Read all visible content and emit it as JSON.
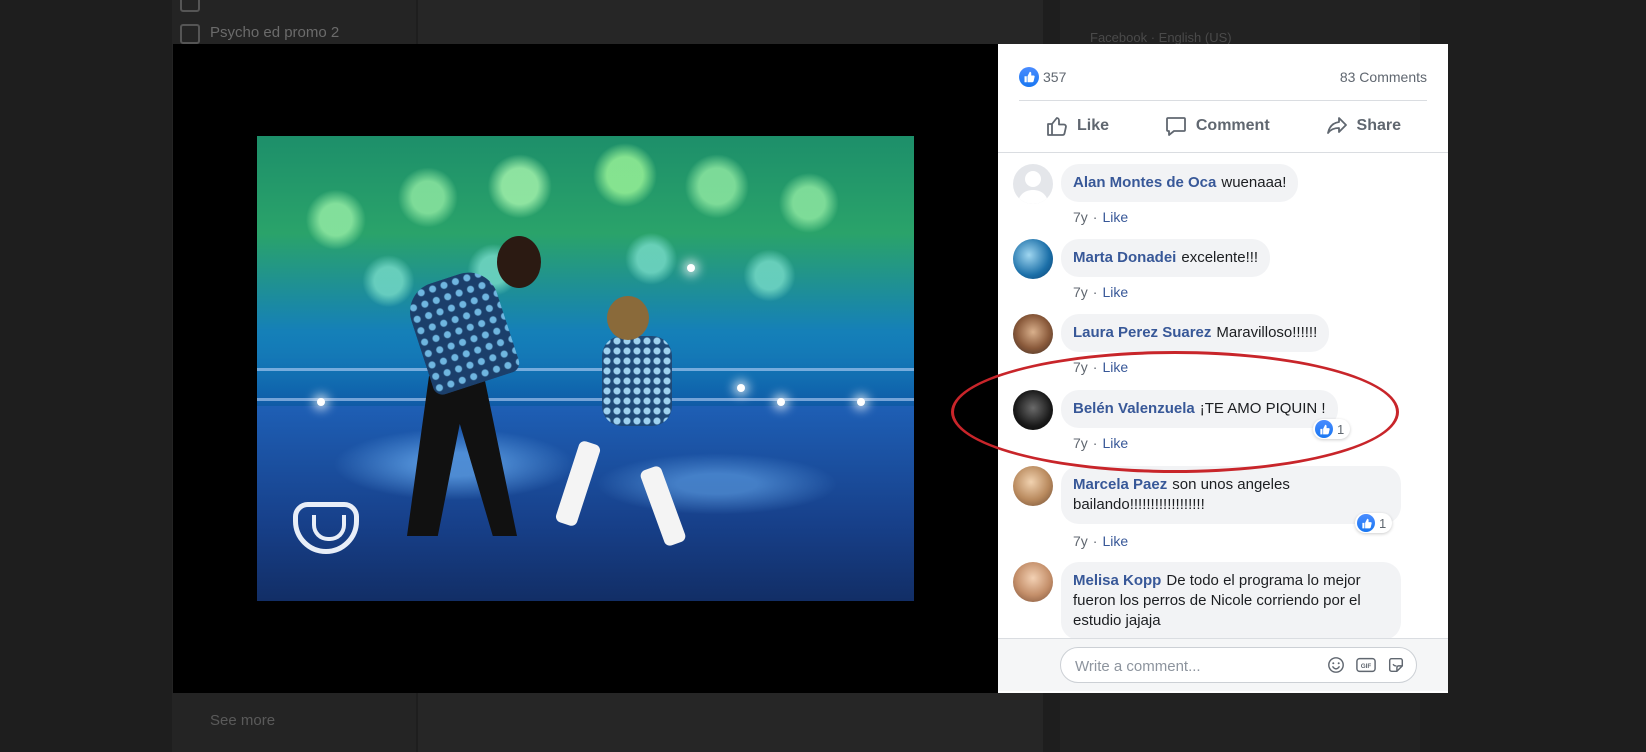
{
  "background": {
    "link_top": "Psycho ed promo 2",
    "link_bottom": "See more",
    "right_header": "Facebook · English (US)"
  },
  "post": {
    "reaction_count": "357",
    "comment_count_label": "83 Comments",
    "actions": {
      "like": "Like",
      "comment": "Comment",
      "share": "Share"
    }
  },
  "comments": [
    {
      "author": "Alan Montes de Oca",
      "text": "wuenaaa!",
      "age": "7y",
      "like_label": "Like",
      "reactions": null
    },
    {
      "author": "Marta Donadei",
      "text": "excelente!!!",
      "age": "7y",
      "like_label": "Like",
      "reactions": null
    },
    {
      "author": "Laura Perez Suarez",
      "text": "Maravilloso!!!!!!",
      "age": "7y",
      "like_label": "Like",
      "reactions": null
    },
    {
      "author": "Belén Valenzuela",
      "text": "¡TE AMO PIQUIN !",
      "age": "7y",
      "like_label": "Like",
      "reactions": "1"
    },
    {
      "author": "Marcela Paez",
      "text": "son unos angeles bailando!!!!!!!!!!!!!!!!!!",
      "age": "7y",
      "like_label": "Like",
      "reactions": "1"
    },
    {
      "author": "Melisa Kopp",
      "text": "De todo el programa lo mejor fueron los perros de Nicole corriendo por el estudio jajaja",
      "age": "",
      "like_label": "",
      "reactions": null
    }
  ],
  "composer": {
    "placeholder": "Write a comment..."
  },
  "colors": {
    "link_blue": "#385898",
    "facebook_blue": "#1877f2",
    "annotation_red": "#c8252a",
    "bubble_bg": "#f2f3f5"
  },
  "icons": {
    "like": "thumbs-up-icon",
    "comment": "speech-bubble-icon",
    "share": "share-arrow-icon",
    "emoji": "smiley-icon",
    "gif": "gif-icon",
    "sticker": "sticker-icon"
  }
}
